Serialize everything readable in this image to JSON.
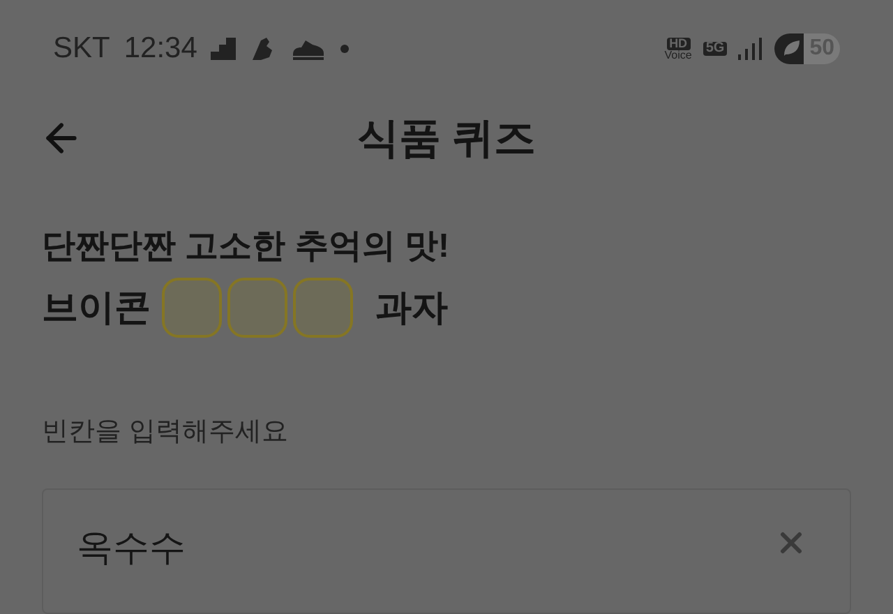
{
  "status_bar": {
    "carrier": "SKT",
    "time": "12:34",
    "hd": "HD",
    "voice": "Voice",
    "network": "5G",
    "battery": "50"
  },
  "header": {
    "title": "식품 퀴즈"
  },
  "quiz": {
    "headline": "단짠단짠 고소한 추억의 맛!",
    "prefix": "브이콘",
    "blanks": [
      {
        "filled": false
      },
      {
        "filled": false
      },
      {
        "filled": false
      }
    ],
    "suffix": "과자"
  },
  "answer": {
    "label": "빈칸을 입력해주세요",
    "value": "옥수수"
  }
}
